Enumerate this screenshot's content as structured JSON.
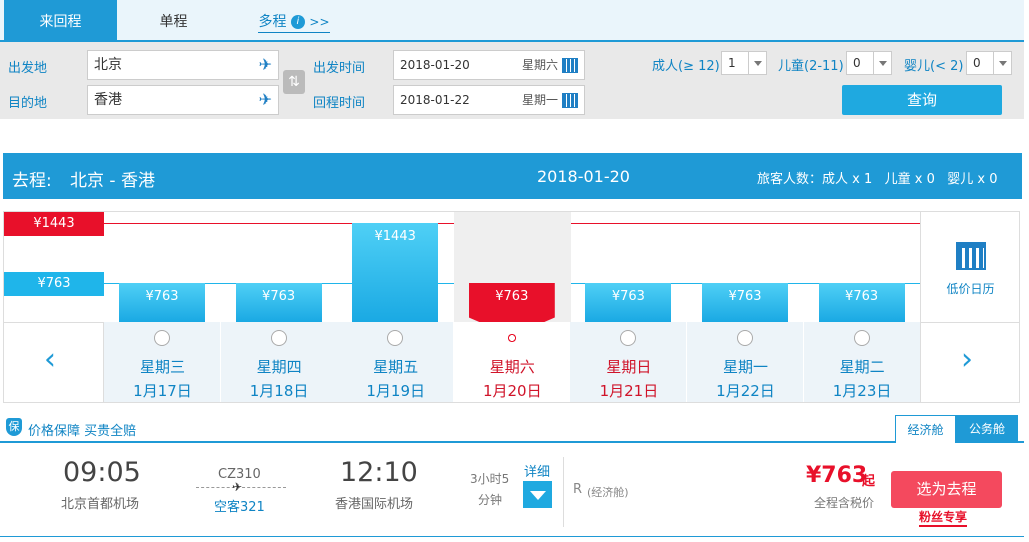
{
  "search_tabs": {
    "round_trip": "来回程",
    "one_way": "单程",
    "multi": "多程",
    "multi_arrow": ">>",
    "info_icon": "i"
  },
  "search": {
    "from_label": "出发地",
    "from_value": "北京",
    "to_label": "目的地",
    "to_value": "香港",
    "depart_label": "出发时间",
    "depart_date": "2018-01-20",
    "depart_weekday": "星期六",
    "return_label": "回程时间",
    "return_date": "2018-01-22",
    "return_weekday": "星期一",
    "adult_label": "成人(≥ 12)",
    "adult_value": "1",
    "child_label": "儿童(2-11)",
    "child_value": "0",
    "infant_label": "婴儿(< 2)",
    "infant_value": "0",
    "search_button": "查询"
  },
  "outbound": {
    "label": "去程:",
    "route": "北京 - 香港",
    "date": "2018-01-20",
    "passengers": "旅客人数：成人 x 1   儿童 x 0   婴儿 x 0"
  },
  "calendar": {
    "max_label": "¥1443",
    "min_label": "¥763",
    "low_price_label": "低价日历",
    "days": [
      {
        "weekday": "星期三",
        "date": "1月17日",
        "price": "¥763",
        "value": 763
      },
      {
        "weekday": "星期四",
        "date": "1月18日",
        "price": "¥763",
        "value": 763
      },
      {
        "weekday": "星期五",
        "date": "1月19日",
        "price": "¥1443",
        "value": 1443
      },
      {
        "weekday": "星期六",
        "date": "1月20日",
        "price": "¥763",
        "value": 763,
        "selected": true
      },
      {
        "weekday": "星期日",
        "date": "1月21日",
        "price": "¥763",
        "value": 763
      },
      {
        "weekday": "星期一",
        "date": "1月22日",
        "price": "¥763",
        "value": 763
      },
      {
        "weekday": "星期二",
        "date": "1月23日",
        "price": "¥763",
        "value": 763
      }
    ]
  },
  "guarantee": {
    "badge": "保",
    "text": "价格保障 买贵全赔",
    "tab_economy": "经济舱",
    "tab_business": "公务舱"
  },
  "flight": {
    "dep_time": "09:05",
    "dep_airport": "北京首都机场",
    "flight_no": "CZ310",
    "aircraft": "空客321",
    "arr_time": "12:10",
    "arr_airport": "香港国际机场",
    "duration_line1": "3小时5",
    "duration_line2": "分钟",
    "detail_label": "详细",
    "cabin": "R",
    "cabin_class": "(经济舱)",
    "price": "¥763",
    "price_suffix": "起",
    "price_note": "全程含税价",
    "select_button": "选为去程",
    "fan_label": "粉丝专享"
  },
  "colors": {
    "accent": "#1f9ad6",
    "price_red": "#e8102a",
    "selected_red": "#e8102a"
  }
}
